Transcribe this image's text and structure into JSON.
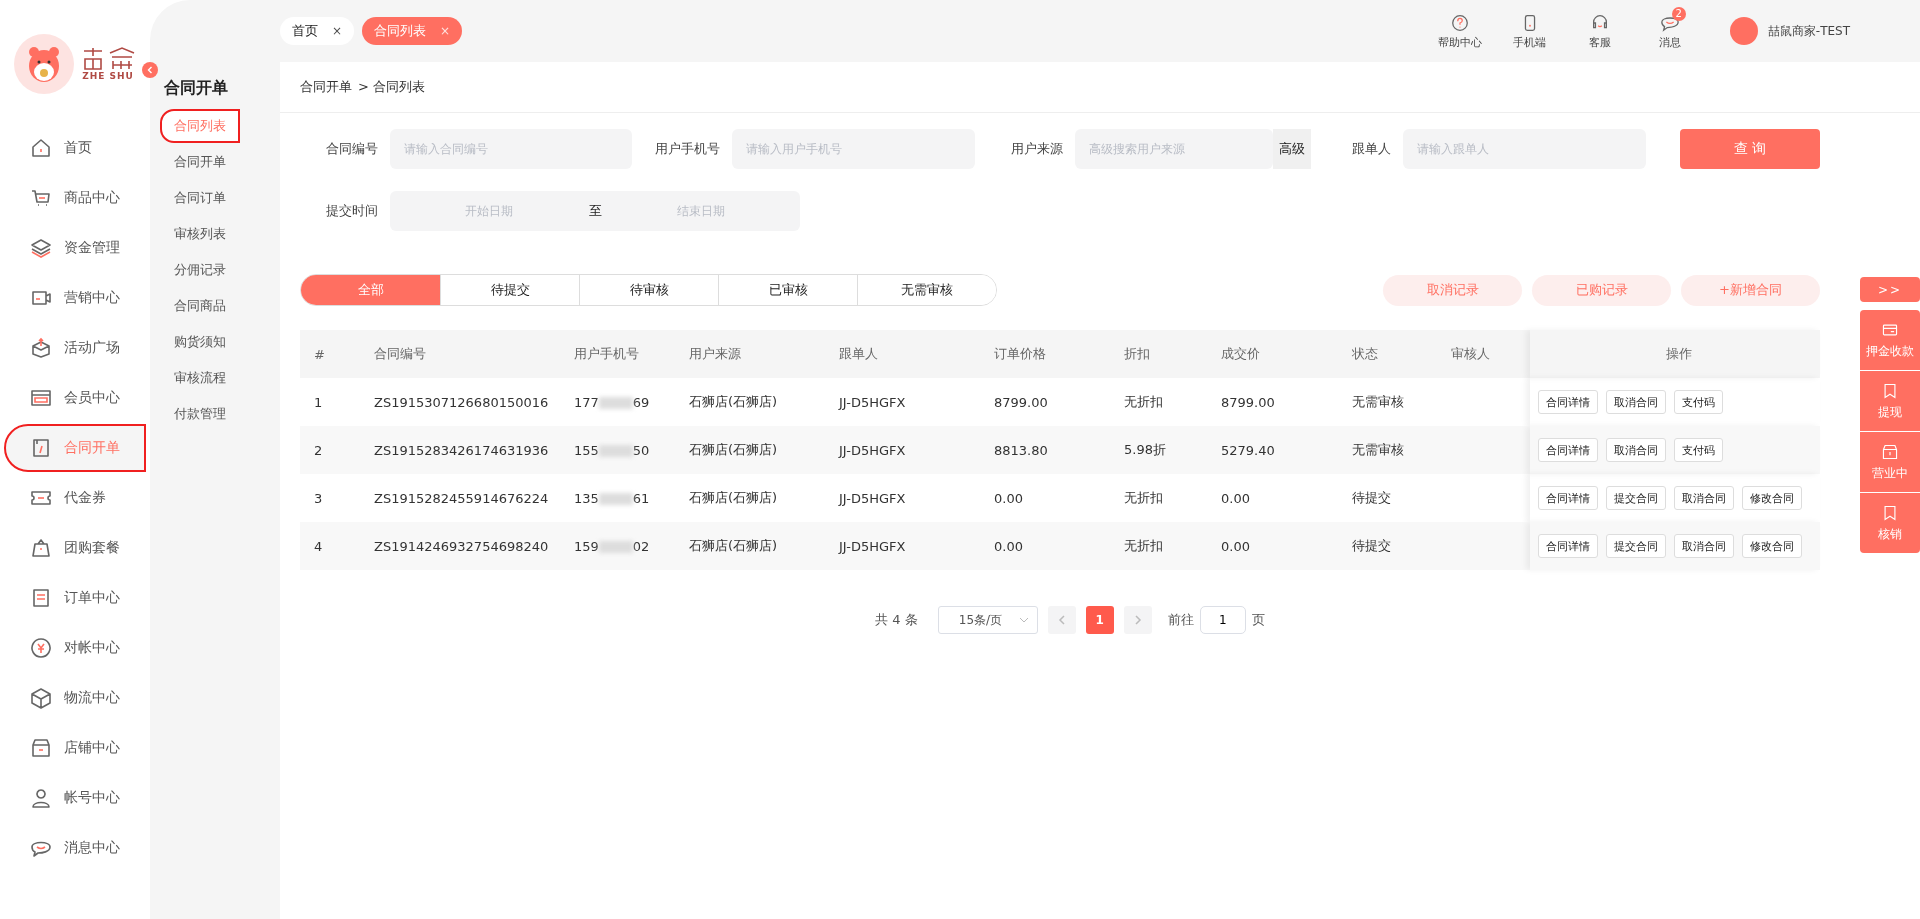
{
  "logo": {
    "text": "ZHE SHU"
  },
  "nav": [
    {
      "label": "首页",
      "selected": false,
      "highlighted": false
    },
    {
      "label": "商品中心",
      "selected": false,
      "highlighted": false
    },
    {
      "label": "资金管理",
      "selected": false,
      "highlighted": false
    },
    {
      "label": "营销中心",
      "selected": false,
      "highlighted": false
    },
    {
      "label": "活动广场",
      "selected": false,
      "highlighted": false
    },
    {
      "label": "会员中心",
      "selected": false,
      "highlighted": false
    },
    {
      "label": "合同开单",
      "selected": true,
      "highlighted": true
    },
    {
      "label": "代金券",
      "selected": false,
      "highlighted": false
    },
    {
      "label": "团购套餐",
      "selected": false,
      "highlighted": false
    },
    {
      "label": "订单中心",
      "selected": false,
      "highlighted": false
    },
    {
      "label": "对帐中心",
      "selected": false,
      "highlighted": false
    },
    {
      "label": "物流中心",
      "selected": false,
      "highlighted": false
    },
    {
      "label": "店铺中心",
      "selected": false,
      "highlighted": false
    },
    {
      "label": "帐号中心",
      "selected": false,
      "highlighted": false
    },
    {
      "label": "消息中心",
      "selected": false,
      "highlighted": false
    }
  ],
  "submenu": {
    "title": "合同开单",
    "items": [
      {
        "label": "合同列表",
        "selected": true,
        "highlighted": true
      },
      {
        "label": "合同开单",
        "selected": false,
        "highlighted": false
      },
      {
        "label": "合同订单",
        "selected": false,
        "highlighted": false
      },
      {
        "label": "审核列表",
        "selected": false,
        "highlighted": false
      },
      {
        "label": "分佣记录",
        "selected": false,
        "highlighted": false
      },
      {
        "label": "合同商品",
        "selected": false,
        "highlighted": false
      },
      {
        "label": "购货须知",
        "selected": false,
        "highlighted": false
      },
      {
        "label": "审核流程",
        "selected": false,
        "highlighted": false
      },
      {
        "label": "付款管理",
        "selected": false,
        "highlighted": false
      }
    ]
  },
  "page_tabs": [
    {
      "label": "首页",
      "close": "×",
      "selected": false
    },
    {
      "label": "合同列表",
      "close": "×",
      "selected": true
    }
  ],
  "header_actions": [
    {
      "label": "帮助中心"
    },
    {
      "label": "手机端"
    },
    {
      "label": "客服"
    },
    {
      "label": "消息",
      "badge": "2"
    }
  ],
  "user": {
    "name": "喆鼠商家-TEST"
  },
  "breadcrumb": [
    "合同开单",
    "> 合同列表"
  ],
  "filters": {
    "contract_no": {
      "label": "合同编号",
      "placeholder": "请输入合同编号"
    },
    "phone": {
      "label": "用户手机号",
      "placeholder": "请输入用户手机号"
    },
    "source": {
      "label": "用户来源",
      "placeholder": "高级搜索用户来源",
      "advanced": "高级"
    },
    "follower": {
      "label": "跟单人",
      "placeholder": "请输入跟单人"
    },
    "submit_time": {
      "label": "提交时间",
      "start_placeholder": "开始日期",
      "separator": "至",
      "end_placeholder": "结束日期"
    },
    "query_button": "查 询"
  },
  "status_tabs": [
    {
      "label": "全部",
      "selected": true
    },
    {
      "label": "待提交",
      "selected": false
    },
    {
      "label": "待审核",
      "selected": false
    },
    {
      "label": "已审核",
      "selected": false
    },
    {
      "label": "无需审核",
      "selected": false
    }
  ],
  "record_buttons": [
    "取消记录",
    "已购记录",
    "+新增合同"
  ],
  "table": {
    "columns": [
      "#",
      "合同编号",
      "用户手机号",
      "用户来源",
      "跟单人",
      "订单价格",
      "折扣",
      "成交价",
      "状态",
      "审核人",
      "操作"
    ],
    "rows": [
      {
        "index": "1",
        "contract_no": "ZS1915307126680150016",
        "phone_start": "177",
        "phone_end": "69",
        "source": "石狮店(石狮店)",
        "follower": "JJ-D5HGFX",
        "price": "8799.00",
        "discount": "无折扣",
        "deal_price": "8799.00",
        "status": "无需审核",
        "actions": [
          "合同详情",
          "取消合同",
          "支付码"
        ]
      },
      {
        "index": "2",
        "contract_no": "ZS1915283426174631936",
        "phone_start": "155",
        "phone_end": "50",
        "source": "石狮店(石狮店)",
        "follower": "JJ-D5HGFX",
        "price": "8813.80",
        "discount": "5.98折",
        "deal_price": "5279.40",
        "status": "无需审核",
        "actions": [
          "合同详情",
          "取消合同",
          "支付码"
        ]
      },
      {
        "index": "3",
        "contract_no": "ZS1915282455914676224",
        "phone_start": "135",
        "phone_end": "61",
        "source": "石狮店(石狮店)",
        "follower": "JJ-D5HGFX",
        "price": "0.00",
        "discount": "无折扣",
        "deal_price": "0.00",
        "status": "待提交",
        "actions": [
          "合同详情",
          "提交合同",
          "取消合同",
          "修改合同"
        ]
      },
      {
        "index": "4",
        "contract_no": "ZS1914246932754698240",
        "phone_start": "159",
        "phone_end": "02",
        "source": "石狮店(石狮店)",
        "follower": "JJ-D5HGFX",
        "price": "0.00",
        "discount": "无折扣",
        "deal_price": "0.00",
        "status": "待提交",
        "actions": [
          "合同详情",
          "提交合同",
          "取消合同",
          "修改合同"
        ]
      }
    ]
  },
  "pagination": {
    "total": "共 4 条",
    "page_size": "15条/页",
    "pages": [
      {
        "label": "1",
        "selected": true
      }
    ],
    "goto_label": "前往",
    "goto_value": "1",
    "goto_suffix": "页"
  },
  "side_panel": {
    "toggle": ">>",
    "items": [
      {
        "label": "押金收款"
      },
      {
        "label": "提现"
      },
      {
        "label": "营业中"
      },
      {
        "label": "核销"
      }
    ]
  }
}
